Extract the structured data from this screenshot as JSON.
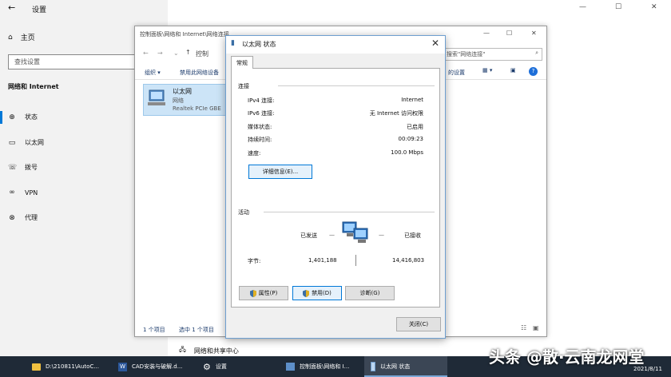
{
  "settings": {
    "title": "设置",
    "back": "←",
    "home": "主页",
    "search_placeholder": "查找设置",
    "category": "网络和 Internet",
    "nav": [
      {
        "icon": "⊕",
        "label": "状态"
      },
      {
        "icon": "▭",
        "label": "以太网"
      },
      {
        "icon": "☏",
        "label": "拨号"
      },
      {
        "icon": "∞",
        "label": "VPN"
      },
      {
        "icon": "⊗",
        "label": "代理"
      }
    ],
    "window_controls": {
      "minimize": "—",
      "maximize": "☐",
      "close": "✕"
    },
    "bottom_link": "网络和共享中心"
  },
  "control_panel": {
    "title": "控制面板\\网络和 Internet\\网络连接",
    "address_prefix": "控制",
    "search_placeholder": "搜索\"网络连接\"",
    "toolbar": {
      "organize": "组织 ▾",
      "disable": "禁用此网络设备",
      "settings_suffix": "的设置"
    },
    "item": {
      "name": "以太网",
      "sub": "网络",
      "adapter": "Realtek PCIe GBE"
    },
    "status": {
      "count": "1 个项目",
      "selected": "选中 1 个项目"
    },
    "window_controls": {
      "minimize": "—",
      "maximize": "☐",
      "close": "✕"
    }
  },
  "dialog": {
    "title": "以太网 状态",
    "close": "✕",
    "tab": "常规",
    "connection_group": "连接",
    "rows": [
      {
        "k": "IPv4 连接:",
        "v": "Internet"
      },
      {
        "k": "IPv6 连接:",
        "v": "无 Internet 访问权限"
      },
      {
        "k": "媒体状态:",
        "v": "已启用"
      },
      {
        "k": "持续时间:",
        "v": "00:09:23"
      },
      {
        "k": "速度:",
        "v": "100.0 Mbps"
      }
    ],
    "details_btn": "详细信息(E)...",
    "activity_group": "活动",
    "sent_label": "已发送",
    "recv_label": "已接收",
    "dash": "—",
    "bytes_label": "字节:",
    "bytes_sent": "1,401,188",
    "bytes_recv": "14,416,803",
    "properties_btn": "属性(P)",
    "disable_btn": "禁用(D)",
    "diagnose_btn": "诊断(G)",
    "close_btn": "关闭(C)"
  },
  "taskbar": {
    "items": [
      {
        "label": "D:\\210811\\AutoC...",
        "icon": "folder-icon"
      },
      {
        "label": "CAD安装与破解.d...",
        "icon": "word-icon"
      },
      {
        "label": "设置",
        "icon": "gear-icon"
      },
      {
        "label": "控制面板\\网络和 I...",
        "icon": "control-panel-icon"
      },
      {
        "label": "以太网 状态",
        "icon": "network-icon"
      }
    ],
    "date": "2021/8/11"
  },
  "watermark": "头条 @散·云南龙网堂"
}
